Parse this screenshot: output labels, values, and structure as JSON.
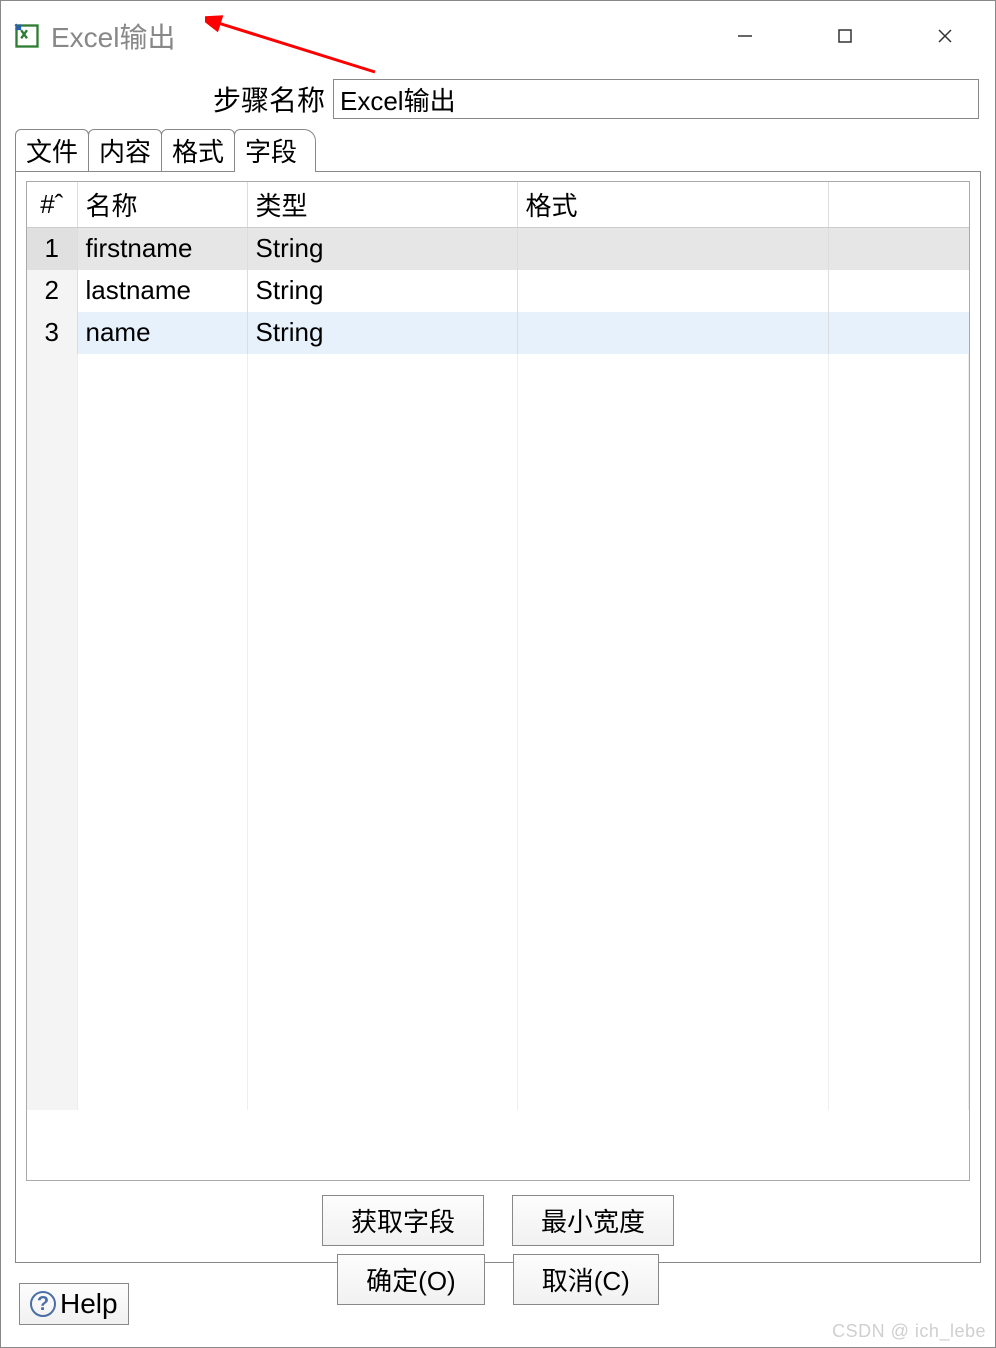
{
  "window": {
    "title": "Excel输出"
  },
  "form": {
    "step_label": "步骤名称",
    "step_value": "Excel输出"
  },
  "tabs": {
    "items": [
      {
        "label": "文件"
      },
      {
        "label": "内容"
      },
      {
        "label": "格式"
      },
      {
        "label": "字段"
      }
    ],
    "active_index": 3
  },
  "table": {
    "headers": {
      "num": "#ˆ",
      "name": "名称",
      "type": "类型",
      "fmt": "格式"
    },
    "rows": [
      {
        "num": "1",
        "name": "firstname",
        "type": "String",
        "fmt": ""
      },
      {
        "num": "2",
        "name": "lastname",
        "type": "String",
        "fmt": ""
      },
      {
        "num": "3",
        "name": "name",
        "type": "String",
        "fmt": ""
      }
    ]
  },
  "panel_buttons": {
    "get_fields": "获取字段",
    "min_width": "最小宽度"
  },
  "bottom_buttons": {
    "ok": "确定(O)",
    "cancel": "取消(C)",
    "help": "Help"
  },
  "watermark": "CSDN @ ich_lebe"
}
